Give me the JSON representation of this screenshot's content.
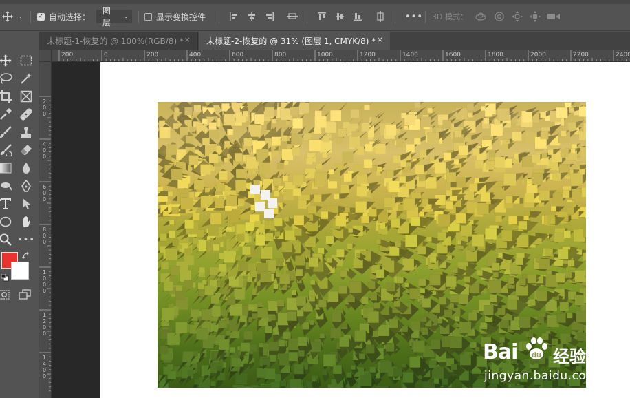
{
  "options_bar": {
    "auto_select_label": "自动选择：",
    "auto_select_value": "图层",
    "show_transform_label": "显示变换控件",
    "mode_3d_label": "3D 模式：",
    "more": "•••"
  },
  "tabs": [
    {
      "label": "未标题-1-恢复的 @ 100%(RGB/8) *",
      "close": "×"
    },
    {
      "label": "未标题-2-恢复的 @ 31% (图层 1, CMYK/8) *",
      "close": "×"
    }
  ],
  "ruler_h": [
    "200",
    "0",
    "200",
    "400",
    "600",
    "800",
    "1000",
    "1200",
    "1400",
    "1600",
    "1800",
    "2000",
    "2200",
    "2400"
  ],
  "ruler_v": [
    "200",
    "400",
    "600",
    "800",
    "1000",
    "1200",
    "1400"
  ],
  "colors": {
    "foreground": "#e8342f",
    "background": "#ffffff"
  },
  "watermark": {
    "brand": "Bai",
    "brand_suffix": "经验",
    "url": "jingyan.baidu.com"
  }
}
